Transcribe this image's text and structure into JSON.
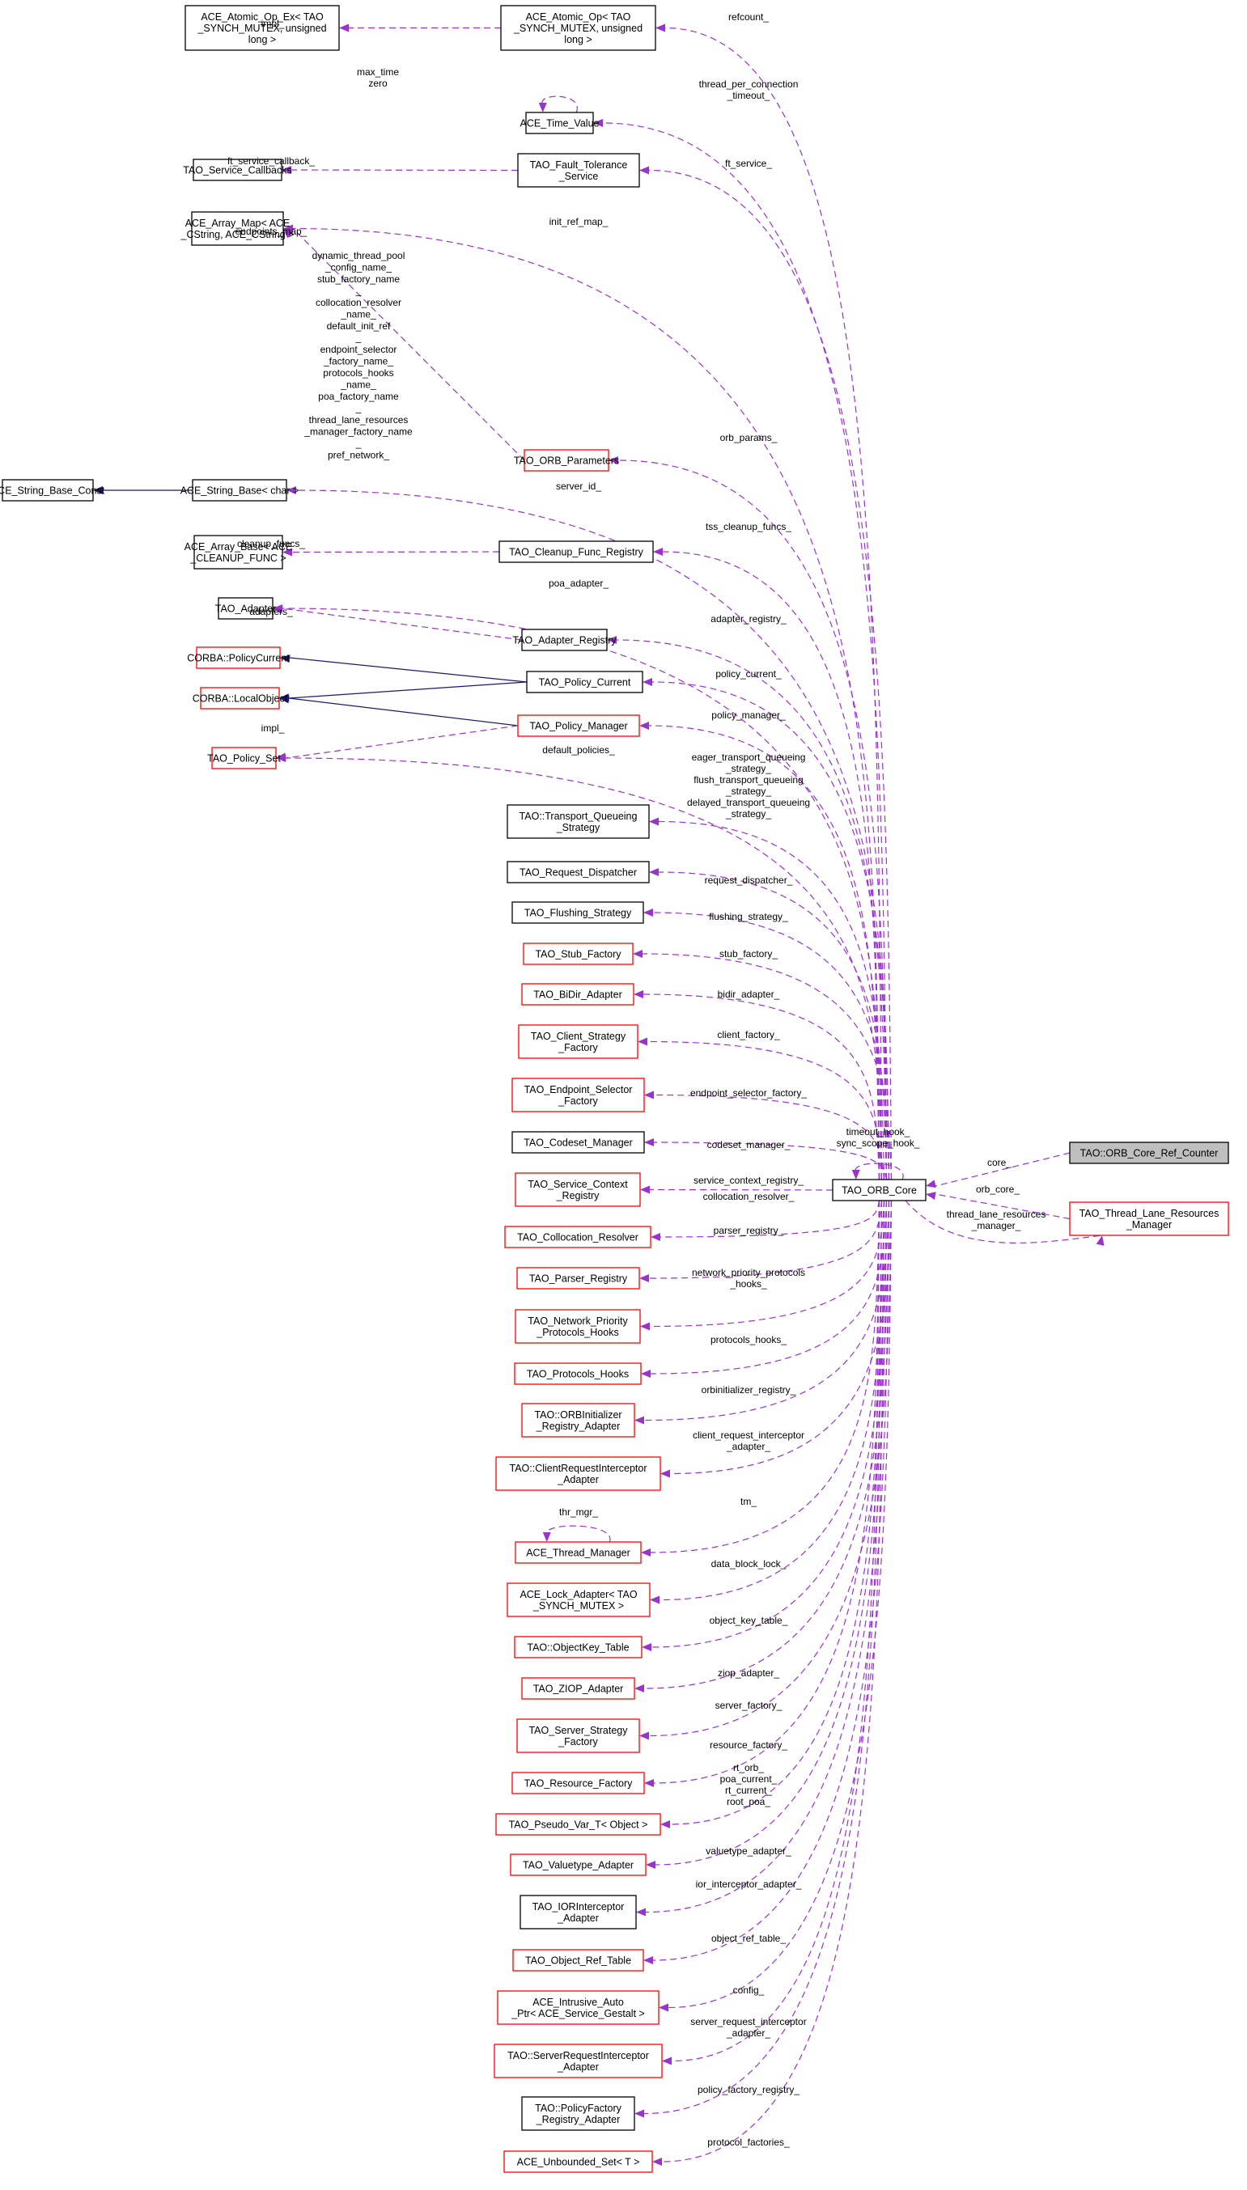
{
  "diagram": {
    "type": "collaboration-graph",
    "focus_node": "TAO::ORB_Core_Ref_Counter",
    "legend_colors": {
      "usage_edge": "#9a32cd",
      "inheritance_edge": "#191970",
      "documented_border": "#000000",
      "undocumented_border": "#ff0000",
      "focus_fill": "#bfbfbf"
    },
    "nodes": [
      {
        "id": "atomic_op_ex",
        "lines": [
          "ACE_Atomic_Op_Ex< TAO",
          "_SYNCH_MUTEX, unsigned",
          "long >"
        ],
        "border": "black"
      },
      {
        "id": "atomic_op",
        "lines": [
          "ACE_Atomic_Op< TAO",
          "_SYNCH_MUTEX, unsigned",
          "long >"
        ],
        "border": "black"
      },
      {
        "id": "time_value",
        "lines": [
          "ACE_Time_Value"
        ],
        "border": "black"
      },
      {
        "id": "service_callbacks",
        "lines": [
          "TAO_Service_Callbacks"
        ],
        "border": "black"
      },
      {
        "id": "fault_tolerance",
        "lines": [
          "TAO_Fault_Tolerance",
          "_Service"
        ],
        "border": "black"
      },
      {
        "id": "array_map",
        "lines": [
          "ACE_Array_Map< ACE",
          "_CString, ACE_CString >"
        ],
        "border": "black"
      },
      {
        "id": "orb_parameters",
        "lines": [
          "TAO_ORB_Parameters"
        ],
        "border": "red"
      },
      {
        "id": "string_base_const",
        "lines": [
          "ACE_String_Base_Const"
        ],
        "border": "black"
      },
      {
        "id": "string_base",
        "lines": [
          "ACE_String_Base< char >"
        ],
        "border": "black"
      },
      {
        "id": "array_base",
        "lines": [
          "ACE_Array_Base< ACE",
          "_CLEANUP_FUNC >"
        ],
        "border": "black"
      },
      {
        "id": "cleanup_registry",
        "lines": [
          "TAO_Cleanup_Func_Registry"
        ],
        "border": "black"
      },
      {
        "id": "adapter",
        "lines": [
          "TAO_Adapter"
        ],
        "border": "black"
      },
      {
        "id": "adapter_registry",
        "lines": [
          "TAO_Adapter_Registry"
        ],
        "border": "black"
      },
      {
        "id": "policy_current_corba",
        "lines": [
          "CORBA::PolicyCurrent"
        ],
        "border": "red"
      },
      {
        "id": "local_object",
        "lines": [
          "CORBA::LocalObject"
        ],
        "border": "red"
      },
      {
        "id": "policy_current",
        "lines": [
          "TAO_Policy_Current"
        ],
        "border": "black"
      },
      {
        "id": "policy_manager",
        "lines": [
          "TAO_Policy_Manager"
        ],
        "border": "red"
      },
      {
        "id": "policy_set",
        "lines": [
          "TAO_Policy_Set"
        ],
        "border": "red"
      },
      {
        "id": "transport_queueing",
        "lines": [
          "TAO::Transport_Queueing",
          "_Strategy"
        ],
        "border": "black"
      },
      {
        "id": "request_dispatcher",
        "lines": [
          "TAO_Request_Dispatcher"
        ],
        "border": "black"
      },
      {
        "id": "flushing_strategy",
        "lines": [
          "TAO_Flushing_Strategy"
        ],
        "border": "black"
      },
      {
        "id": "stub_factory",
        "lines": [
          "TAO_Stub_Factory"
        ],
        "border": "red"
      },
      {
        "id": "bidir_adapter",
        "lines": [
          "TAO_BiDir_Adapter"
        ],
        "border": "red"
      },
      {
        "id": "client_strategy",
        "lines": [
          "TAO_Client_Strategy",
          "_Factory"
        ],
        "border": "red"
      },
      {
        "id": "endpoint_selector",
        "lines": [
          "TAO_Endpoint_Selector",
          "_Factory"
        ],
        "border": "red"
      },
      {
        "id": "codeset_manager",
        "lines": [
          "TAO_Codeset_Manager"
        ],
        "border": "black"
      },
      {
        "id": "service_context",
        "lines": [
          "TAO_Service_Context",
          "_Registry"
        ],
        "border": "red"
      },
      {
        "id": "collocation_resolver",
        "lines": [
          "TAO_Collocation_Resolver"
        ],
        "border": "red"
      },
      {
        "id": "parser_registry",
        "lines": [
          "TAO_Parser_Registry"
        ],
        "border": "red"
      },
      {
        "id": "network_priority",
        "lines": [
          "TAO_Network_Priority",
          "_Protocols_Hooks"
        ],
        "border": "red"
      },
      {
        "id": "protocols_hooks",
        "lines": [
          "TAO_Protocols_Hooks"
        ],
        "border": "red"
      },
      {
        "id": "orbinitializer",
        "lines": [
          "TAO::ORBInitializer",
          "_Registry_Adapter"
        ],
        "border": "red"
      },
      {
        "id": "client_interceptor",
        "lines": [
          "TAO::ClientRequestInterceptor",
          "_Adapter"
        ],
        "border": "red"
      },
      {
        "id": "thread_manager",
        "lines": [
          "ACE_Thread_Manager"
        ],
        "border": "red"
      },
      {
        "id": "lock_adapter",
        "lines": [
          "ACE_Lock_Adapter< TAO",
          "_SYNCH_MUTEX >"
        ],
        "border": "red"
      },
      {
        "id": "objectkey_table",
        "lines": [
          "TAO::ObjectKey_Table"
        ],
        "border": "red"
      },
      {
        "id": "ziop_adapter",
        "lines": [
          "TAO_ZIOP_Adapter"
        ],
        "border": "red"
      },
      {
        "id": "server_strategy",
        "lines": [
          "TAO_Server_Strategy",
          "_Factory"
        ],
        "border": "red"
      },
      {
        "id": "resource_factory",
        "lines": [
          "TAO_Resource_Factory"
        ],
        "border": "red"
      },
      {
        "id": "pseudo_var",
        "lines": [
          "TAO_Pseudo_Var_T< Object >"
        ],
        "border": "red"
      },
      {
        "id": "valuetype_adapter",
        "lines": [
          "TAO_Valuetype_Adapter"
        ],
        "border": "red"
      },
      {
        "id": "ior_interceptor",
        "lines": [
          "TAO_IORInterceptor",
          "_Adapter"
        ],
        "border": "black"
      },
      {
        "id": "object_ref_table",
        "lines": [
          "TAO_Object_Ref_Table"
        ],
        "border": "red"
      },
      {
        "id": "intrusive_auto_ptr",
        "lines": [
          "ACE_Intrusive_Auto",
          "_Ptr< ACE_Service_Gestalt >"
        ],
        "border": "red"
      },
      {
        "id": "server_interceptor",
        "lines": [
          "TAO::ServerRequestInterceptor",
          "_Adapter"
        ],
        "border": "red"
      },
      {
        "id": "policy_factory",
        "lines": [
          "TAO::PolicyFactory",
          "_Registry_Adapter"
        ],
        "border": "black"
      },
      {
        "id": "unbounded_set",
        "lines": [
          "ACE_Unbounded_Set< T >"
        ],
        "border": "red"
      },
      {
        "id": "orb_core",
        "lines": [
          "TAO_ORB_Core"
        ],
        "border": "black"
      },
      {
        "id": "ref_counter",
        "lines": [
          "TAO::ORB_Core_Ref_Counter"
        ],
        "border": "black",
        "focus": true
      },
      {
        "id": "thread_lane",
        "lines": [
          "TAO_Thread_Lane_Resources",
          "_Manager"
        ],
        "border": "red"
      }
    ],
    "edges": [
      {
        "label": [
          "impl_"
        ]
      },
      {
        "label": [
          "refcount_"
        ]
      },
      {
        "label": [
          "max_time",
          "zero"
        ]
      },
      {
        "label": [
          "thread_per_connection",
          "_timeout_"
        ]
      },
      {
        "label": [
          "ft_service_callback_"
        ]
      },
      {
        "label": [
          "ft_service_"
        ]
      },
      {
        "label": [
          "init_ref_map_"
        ]
      },
      {
        "label": [
          "endpoints_map_"
        ]
      },
      {
        "label": [
          "dynamic_thread_pool",
          "_config_name_",
          "stub_factory_name",
          "_",
          "collocation_resolver",
          "_name_",
          "default_init_ref",
          "_",
          "endpoint_selector",
          "_factory_name_",
          "protocols_hooks",
          "_name_",
          "poa_factory_name",
          "_",
          "thread_lane_resources",
          "_manager_factory_name",
          "_",
          "pref_network_"
        ]
      },
      {
        "label": [
          "orb_params_"
        ]
      },
      {
        "label": [
          "server_id_"
        ]
      },
      {
        "label": [
          "cleanup_funcs_"
        ]
      },
      {
        "label": [
          "tss_cleanup_funcs_"
        ]
      },
      {
        "label": [
          "poa_adapter_"
        ]
      },
      {
        "label": [
          "adapters_"
        ]
      },
      {
        "label": [
          "adapter_registry_"
        ]
      },
      {
        "label": [
          "policy_current_"
        ]
      },
      {
        "label": [
          "impl_"
        ]
      },
      {
        "label": [
          "policy_manager_"
        ]
      },
      {
        "label": [
          "default_policies_"
        ]
      },
      {
        "label": [
          "eager_transport_queueing",
          "_strategy_",
          "flush_transport_queueing",
          "_strategy_",
          "delayed_transport_queueing",
          "_strategy_"
        ]
      },
      {
        "label": [
          "request_dispatcher_"
        ]
      },
      {
        "label": [
          "flushing_strategy_"
        ]
      },
      {
        "label": [
          "stub_factory_"
        ]
      },
      {
        "label": [
          "bidir_adapter_"
        ]
      },
      {
        "label": [
          "client_factory_"
        ]
      },
      {
        "label": [
          "endpoint_selector_factory_"
        ]
      },
      {
        "label": [
          "codeset_manager_"
        ]
      },
      {
        "label": [
          "timeout_hook_",
          "sync_scope_hook_"
        ]
      },
      {
        "label": [
          "service_context_registry_"
        ]
      },
      {
        "label": [
          "collocation_resolver_"
        ]
      },
      {
        "label": [
          "parser_registry_"
        ]
      },
      {
        "label": [
          "network_priority_protocols",
          "_hooks_"
        ]
      },
      {
        "label": [
          "protocols_hooks_"
        ]
      },
      {
        "label": [
          "orbinitializer_registry_"
        ]
      },
      {
        "label": [
          "client_request_interceptor",
          "_adapter_"
        ]
      },
      {
        "label": [
          "tm_"
        ]
      },
      {
        "label": [
          "thr_mgr_"
        ]
      },
      {
        "label": [
          "data_block_lock_"
        ]
      },
      {
        "label": [
          "object_key_table_"
        ]
      },
      {
        "label": [
          "ziop_adapter_"
        ]
      },
      {
        "label": [
          "server_factory_"
        ]
      },
      {
        "label": [
          "resource_factory_"
        ]
      },
      {
        "label": [
          "rt_orb_",
          "poa_current_",
          "rt_current_",
          "root_poa_"
        ]
      },
      {
        "label": [
          "valuetype_adapter_"
        ]
      },
      {
        "label": [
          "ior_interceptor_adapter_"
        ]
      },
      {
        "label": [
          "object_ref_table_"
        ]
      },
      {
        "label": [
          "config_"
        ]
      },
      {
        "label": [
          "server_request_interceptor",
          "_adapter_"
        ]
      },
      {
        "label": [
          "policy_factory_registry_"
        ]
      },
      {
        "label": [
          "protocol_factories_"
        ]
      },
      {
        "label": [
          "core_"
        ]
      },
      {
        "label": [
          "orb_core_"
        ]
      },
      {
        "label": [
          "thread_lane_resources",
          "_manager_"
        ]
      }
    ]
  }
}
